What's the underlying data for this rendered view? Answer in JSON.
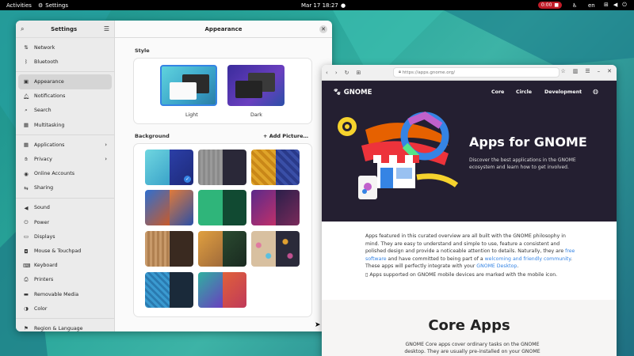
{
  "topbar": {
    "activities": "Activities",
    "app_name": "Settings",
    "clock": "Mar 17  18:27",
    "record_time": "0:00",
    "language": "en"
  },
  "settings": {
    "sidebar_title": "Settings",
    "header_title": "Appearance",
    "sidebar": [
      {
        "label": "Network",
        "icon": "network-icon"
      },
      {
        "label": "Bluetooth",
        "icon": "bluetooth-icon"
      },
      {
        "label": "Appearance",
        "icon": "appearance-icon",
        "active": true
      },
      {
        "label": "Notifications",
        "icon": "bell-icon"
      },
      {
        "label": "Search",
        "icon": "search-icon"
      },
      {
        "label": "Multitasking",
        "icon": "multitasking-icon"
      },
      {
        "label": "Applications",
        "icon": "apps-icon",
        "chevron": true
      },
      {
        "label": "Privacy",
        "icon": "hand-icon",
        "chevron": true
      },
      {
        "label": "Online Accounts",
        "icon": "accounts-icon"
      },
      {
        "label": "Sharing",
        "icon": "sharing-icon"
      },
      {
        "label": "Sound",
        "icon": "sound-icon"
      },
      {
        "label": "Power",
        "icon": "power-icon"
      },
      {
        "label": "Displays",
        "icon": "display-icon"
      },
      {
        "label": "Mouse & Touchpad",
        "icon": "mouse-icon"
      },
      {
        "label": "Keyboard",
        "icon": "keyboard-icon"
      },
      {
        "label": "Printers",
        "icon": "printer-icon"
      },
      {
        "label": "Removable Media",
        "icon": "media-icon"
      },
      {
        "label": "Color",
        "icon": "color-icon"
      },
      {
        "label": "Region & Language",
        "icon": "flag-icon"
      }
    ],
    "style_label": "Style",
    "style_light": "Light",
    "style_dark": "Dark",
    "background_label": "Background",
    "add_picture": "Add Picture…"
  },
  "browser": {
    "url": "https://apps.gnome.org/",
    "logo": "GNOME",
    "nav": [
      "Core",
      "Circle",
      "Development"
    ],
    "hero_title": "Apps for GNOME",
    "hero_sub": "Discover the best applications in the GNOME ecosystem and learn how to get involved.",
    "para_1": "Apps featured in this curated overview are all built with the GNOME philosophy in mind. They are easy to understand and simple to use, feature a consistent and polished design and provide a noticeable attention to details. Naturally, they are ",
    "link_free": "free software",
    "para_2": " and have committed to being part of a ",
    "link_community": "welcoming and friendly community",
    "para_3": ". These apps will perfectly integrate with your ",
    "link_desktop": "GNOME Desktop",
    "para_4": ".",
    "mobile_note": "Apps supported on GNOME mobile devices are marked with the mobile icon.",
    "core_title": "Core Apps",
    "core_text": "GNOME Core apps cover ordinary tasks on the GNOME desktop. They are usually pre-installed on your GNOME"
  }
}
